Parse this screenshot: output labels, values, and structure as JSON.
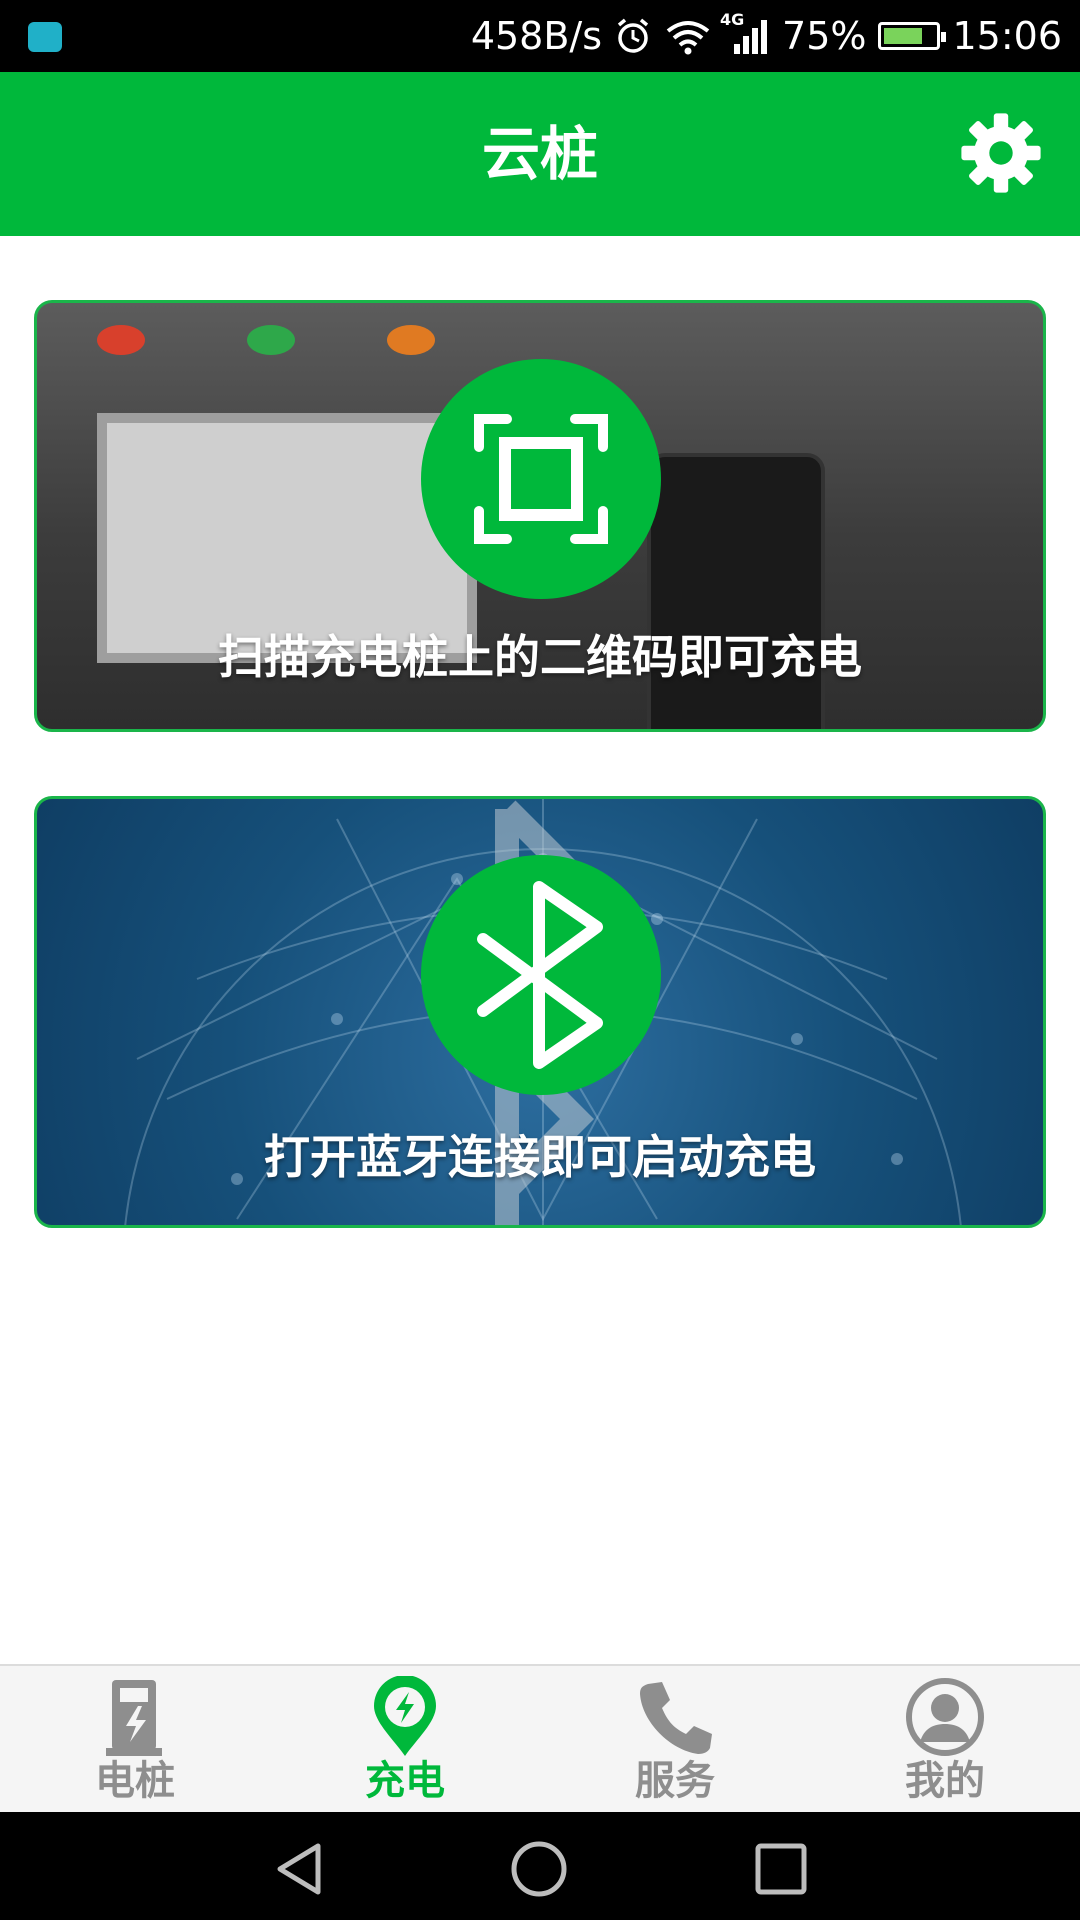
{
  "status_bar": {
    "speed": "458B/s",
    "network": "4G",
    "battery": "75%",
    "battery_level": 0.75,
    "time": "15:06"
  },
  "app_bar": {
    "title": "云桩",
    "settings_icon": "gear-icon"
  },
  "cards": {
    "scan": {
      "label": "扫描充电桩上的二维码即可充电",
      "icon": "qr-scan-icon"
    },
    "bluetooth": {
      "label": "打开蓝牙连接即可启动充电",
      "icon": "bluetooth-icon"
    }
  },
  "bottom_nav": {
    "items": [
      {
        "label": "电桩",
        "icon": "charging-pile-icon",
        "active": false
      },
      {
        "label": "充电",
        "icon": "charge-location-icon",
        "active": true
      },
      {
        "label": "服务",
        "icon": "phone-icon",
        "active": false
      },
      {
        "label": "我的",
        "icon": "user-icon",
        "active": false
      }
    ]
  },
  "colors": {
    "brand_green": "#00b83b",
    "inactive_gray": "#8e8e8e"
  }
}
